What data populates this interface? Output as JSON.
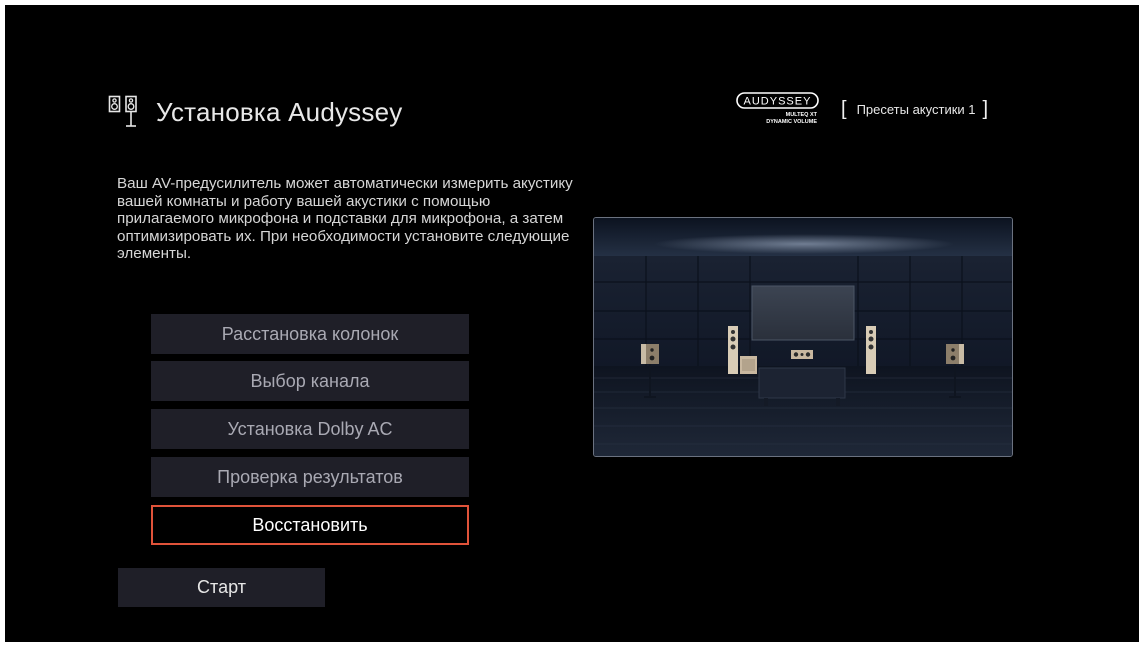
{
  "header": {
    "title": "Установка Audyssey",
    "title_icon": "speakers-icon",
    "brand": {
      "line1": "AUDYSSEY",
      "line2": "MULTEQ XT",
      "line3": "DYNAMIC VOLUME"
    },
    "preset": {
      "open_bracket": "[",
      "label": "Пресеты акустики 1",
      "close_bracket": "]"
    }
  },
  "description": "Ваш AV-предусилитель может автоматически измерить акустику вашей комнаты и работу вашей акустики с помощью прилагаемого микрофона и подставки для микрофона, а затем оптимизировать их. При необходимости установите следующие элементы.",
  "menu": {
    "items": [
      {
        "label": "Расстановка колонок",
        "selected": false
      },
      {
        "label": "Выбор канала",
        "selected": false
      },
      {
        "label": "Установка Dolby AC",
        "selected": false
      },
      {
        "label": "Проверка результатов",
        "selected": false
      },
      {
        "label": "Восстановить",
        "selected": true
      }
    ],
    "start_label": "Старт"
  },
  "colors": {
    "background": "#000000",
    "button_bg": "#1f1f28",
    "button_text": "#a9a9b3",
    "selected_border": "#e0533a",
    "text": "#e8e8e8"
  },
  "illustration": "home-theater-room-illustration"
}
